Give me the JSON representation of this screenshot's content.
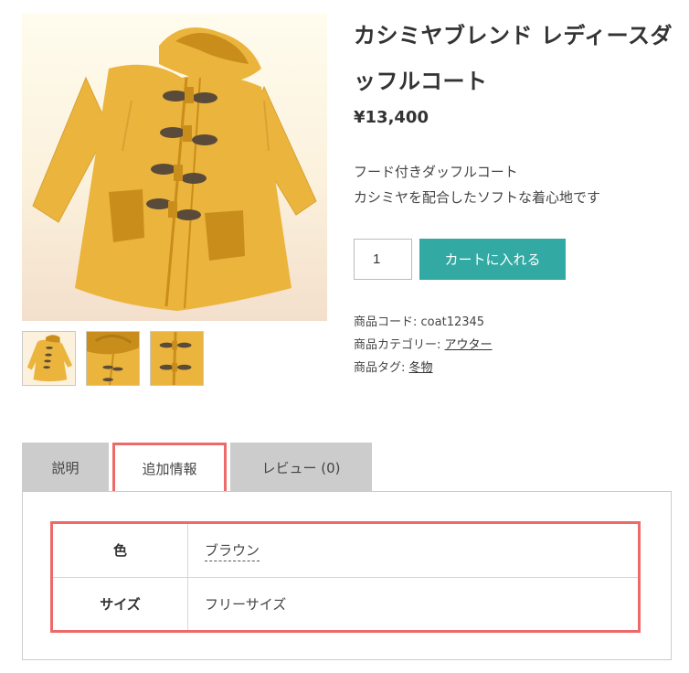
{
  "product": {
    "title": "カシミヤブレンド レディースダッフルコート",
    "price": "¥13,400",
    "description_lines": [
      "フード付きダッフルコート",
      "カシミヤを配合したソフトな着心地です"
    ],
    "quantity": "1",
    "add_to_cart": "カートに入れる",
    "meta": {
      "code_label": "商品コード:",
      "code_value": "coat12345",
      "category_label": "商品カテゴリー:",
      "category_value": "アウター",
      "tag_label": "商品タグ:",
      "tag_value": "冬物"
    }
  },
  "gallery": {
    "main_image": "mustard-duffle-coat-illustration",
    "thumbnails": [
      "full-coat",
      "hood-detail",
      "toggle-detail"
    ]
  },
  "tabs": [
    {
      "label": "説明",
      "active": false
    },
    {
      "label": "追加情報",
      "active": true
    },
    {
      "label": "レビュー (0)",
      "active": false
    }
  ],
  "additional_info": [
    {
      "label": "色",
      "value": "ブラウン"
    },
    {
      "label": "サイズ",
      "value": "フリーサイズ"
    }
  ],
  "colors": {
    "accent": "#33a9a3",
    "highlight": "#ee6a6a",
    "coat": "#ebb43c",
    "coat_dark": "#c98d1c",
    "toggle": "#5a4a3a"
  }
}
